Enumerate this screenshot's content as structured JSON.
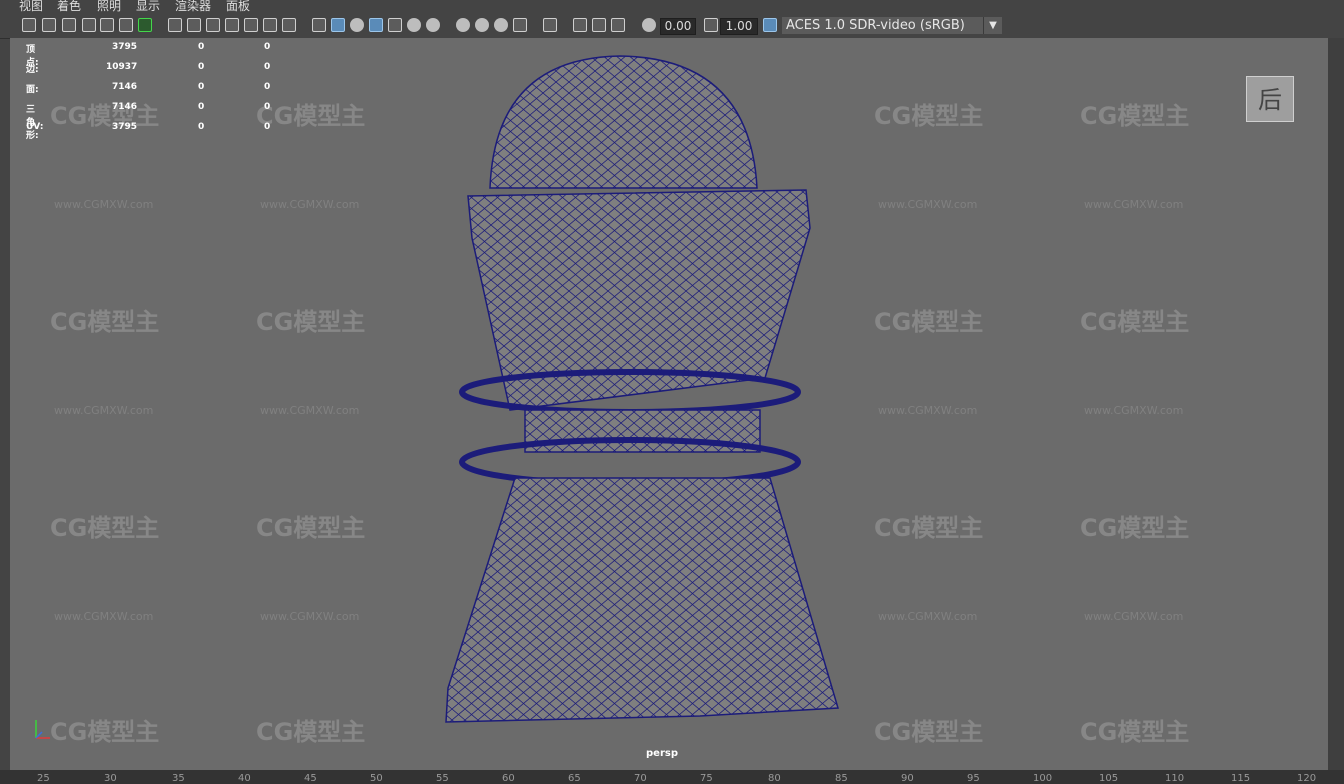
{
  "menu": [
    "视图",
    "着色",
    "照明",
    "显示",
    "渲染器",
    "面板"
  ],
  "toolbar": {
    "exposure": "0.00",
    "gamma": "1.00",
    "color_space": "ACES 1.0 SDR-video (sRGB)"
  },
  "hud": {
    "rows": [
      {
        "label": "顶点:",
        "value": "3795",
        "sel": "0",
        "comp": "0"
      },
      {
        "label": "边:",
        "value": "10937",
        "sel": "0",
        "comp": "0"
      },
      {
        "label": "面:",
        "value": "7146",
        "sel": "0",
        "comp": "0"
      },
      {
        "label": "三角形:",
        "value": "7146",
        "sel": "0",
        "comp": "0"
      },
      {
        "label": "UV:",
        "value": "3795",
        "sel": "0",
        "comp": "0"
      }
    ]
  },
  "viewcube_label": "后",
  "camera_label": "persp",
  "watermark": {
    "logo": "CG模型主",
    "url": "www.CGMXW.com"
  },
  "ruler": [
    "25",
    "30",
    "35",
    "40",
    "45",
    "50",
    "55",
    "60",
    "65",
    "70",
    "75",
    "80",
    "85",
    "90",
    "95",
    "100",
    "105",
    "110",
    "115",
    "120"
  ],
  "colors": {
    "viewport": "#6b6b6b",
    "wire": "#1c1c7a",
    "mesh": "#808080",
    "accent": "#5a8bb8"
  }
}
